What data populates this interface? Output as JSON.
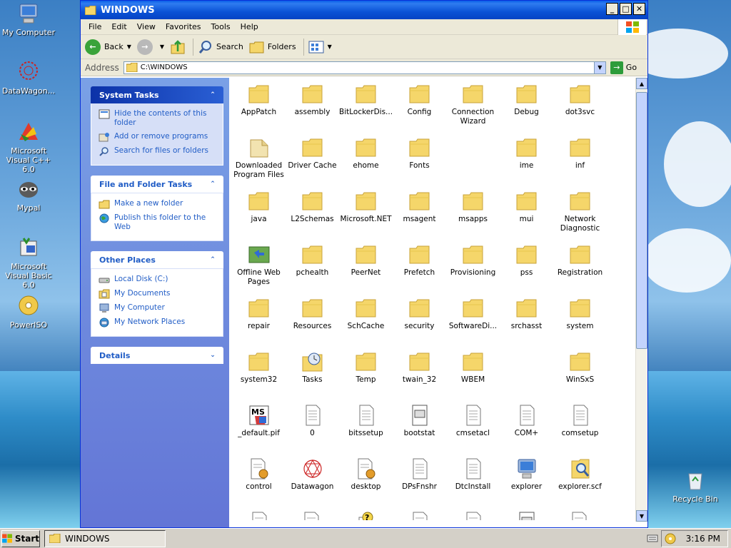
{
  "desktop": {
    "icons": [
      {
        "label": "My Computer",
        "icon": "my-computer-icon"
      },
      {
        "label": "DataWagon...",
        "icon": "datawagon-icon"
      },
      {
        "label": "Microsoft Visual C++ 6.0",
        "icon": "visual-cpp-icon"
      },
      {
        "label": "Mypal",
        "icon": "mypal-icon"
      },
      {
        "label": "Microsoft Visual Basic 6.0",
        "icon": "visual-basic-icon"
      },
      {
        "label": "PowerISO",
        "icon": "poweriso-icon"
      },
      {
        "label": "Recycle Bin",
        "icon": "recycle-bin-icon"
      }
    ]
  },
  "window": {
    "title": "WINDOWS",
    "menu": [
      "File",
      "Edit",
      "View",
      "Favorites",
      "Tools",
      "Help"
    ],
    "toolbar": {
      "back": "Back",
      "search": "Search",
      "folders": "Folders"
    },
    "address": {
      "label": "Address",
      "value": "C:\\WINDOWS",
      "go": "Go"
    }
  },
  "taskpane": {
    "system_tasks": {
      "title": "System Tasks",
      "items": [
        "Hide the contents of this folder",
        "Add or remove programs",
        "Search for files or folders"
      ]
    },
    "file_folder_tasks": {
      "title": "File and Folder Tasks",
      "items": [
        "Make a new folder",
        "Publish this folder to the Web"
      ]
    },
    "other_places": {
      "title": "Other Places",
      "items": [
        "Local Disk (C:)",
        "My Documents",
        "My Computer",
        "My Network Places"
      ]
    },
    "details": {
      "title": "Details"
    }
  },
  "files": [
    {
      "name": "AppPatch",
      "type": "folder"
    },
    {
      "name": "assembly",
      "type": "folder"
    },
    {
      "name": "BitLockerDis...",
      "type": "folder"
    },
    {
      "name": "Config",
      "type": "folder"
    },
    {
      "name": "Connection Wizard",
      "type": "folder"
    },
    {
      "name": "Debug",
      "type": "folder"
    },
    {
      "name": "dot3svc",
      "type": "folder"
    },
    {
      "name": "Downloaded Program Files",
      "type": "folder-open"
    },
    {
      "name": "Driver Cache",
      "type": "folder"
    },
    {
      "name": "ehome",
      "type": "folder"
    },
    {
      "name": "Fonts",
      "type": "folder"
    },
    {
      "name": "",
      "type": "empty"
    },
    {
      "name": "ime",
      "type": "folder"
    },
    {
      "name": "inf",
      "type": "folder"
    },
    {
      "name": "java",
      "type": "folder"
    },
    {
      "name": "L2Schemas",
      "type": "folder"
    },
    {
      "name": "Microsoft.NET",
      "type": "folder"
    },
    {
      "name": "msagent",
      "type": "folder"
    },
    {
      "name": "msapps",
      "type": "folder"
    },
    {
      "name": "mui",
      "type": "folder"
    },
    {
      "name": "Network Diagnostic",
      "type": "folder"
    },
    {
      "name": "Offline Web Pages",
      "type": "offline"
    },
    {
      "name": "pchealth",
      "type": "folder"
    },
    {
      "name": "PeerNet",
      "type": "folder"
    },
    {
      "name": "Prefetch",
      "type": "folder"
    },
    {
      "name": "Provisioning",
      "type": "folder"
    },
    {
      "name": "pss",
      "type": "folder"
    },
    {
      "name": "Registration",
      "type": "folder"
    },
    {
      "name": "repair",
      "type": "folder"
    },
    {
      "name": "Resources",
      "type": "folder"
    },
    {
      "name": "SchCache",
      "type": "folder"
    },
    {
      "name": "security",
      "type": "folder"
    },
    {
      "name": "SoftwareDi...",
      "type": "folder"
    },
    {
      "name": "srchasst",
      "type": "folder"
    },
    {
      "name": "system",
      "type": "folder"
    },
    {
      "name": "system32",
      "type": "folder"
    },
    {
      "name": "Tasks",
      "type": "tasks"
    },
    {
      "name": "Temp",
      "type": "folder"
    },
    {
      "name": "twain_32",
      "type": "folder"
    },
    {
      "name": "WBEM",
      "type": "folder"
    },
    {
      "name": "",
      "type": "empty"
    },
    {
      "name": "WinSxS",
      "type": "folder"
    },
    {
      "name": "_default.pif",
      "type": "msdos"
    },
    {
      "name": "0",
      "type": "doc"
    },
    {
      "name": "bitssetup",
      "type": "doc"
    },
    {
      "name": "bootstat",
      "type": "dat"
    },
    {
      "name": "cmsetacl",
      "type": "doc"
    },
    {
      "name": "COM+",
      "type": "doc"
    },
    {
      "name": "comsetup",
      "type": "doc"
    },
    {
      "name": "control",
      "type": "settings"
    },
    {
      "name": "Datawagon",
      "type": "datawagon"
    },
    {
      "name": "desktop",
      "type": "settings"
    },
    {
      "name": "DPsFnshr",
      "type": "doc"
    },
    {
      "name": "DtcInstall",
      "type": "doc"
    },
    {
      "name": "explorer",
      "type": "explorer"
    },
    {
      "name": "explorer.scf",
      "type": "scf"
    },
    {
      "name": "",
      "type": "doc"
    },
    {
      "name": "",
      "type": "settings"
    },
    {
      "name": "",
      "type": "help"
    },
    {
      "name": "",
      "type": "doc"
    },
    {
      "name": "",
      "type": "doc"
    },
    {
      "name": "",
      "type": "dat"
    },
    {
      "name": "",
      "type": "settings"
    }
  ],
  "taskbar": {
    "start": "Start",
    "task": "WINDOWS",
    "clock": "3:16 PM"
  },
  "colors": {
    "titlebar": "#0a52d6",
    "taskpane": "#6375d6",
    "folder": "#f5d66a",
    "taskbar": "#d4d0c8"
  }
}
